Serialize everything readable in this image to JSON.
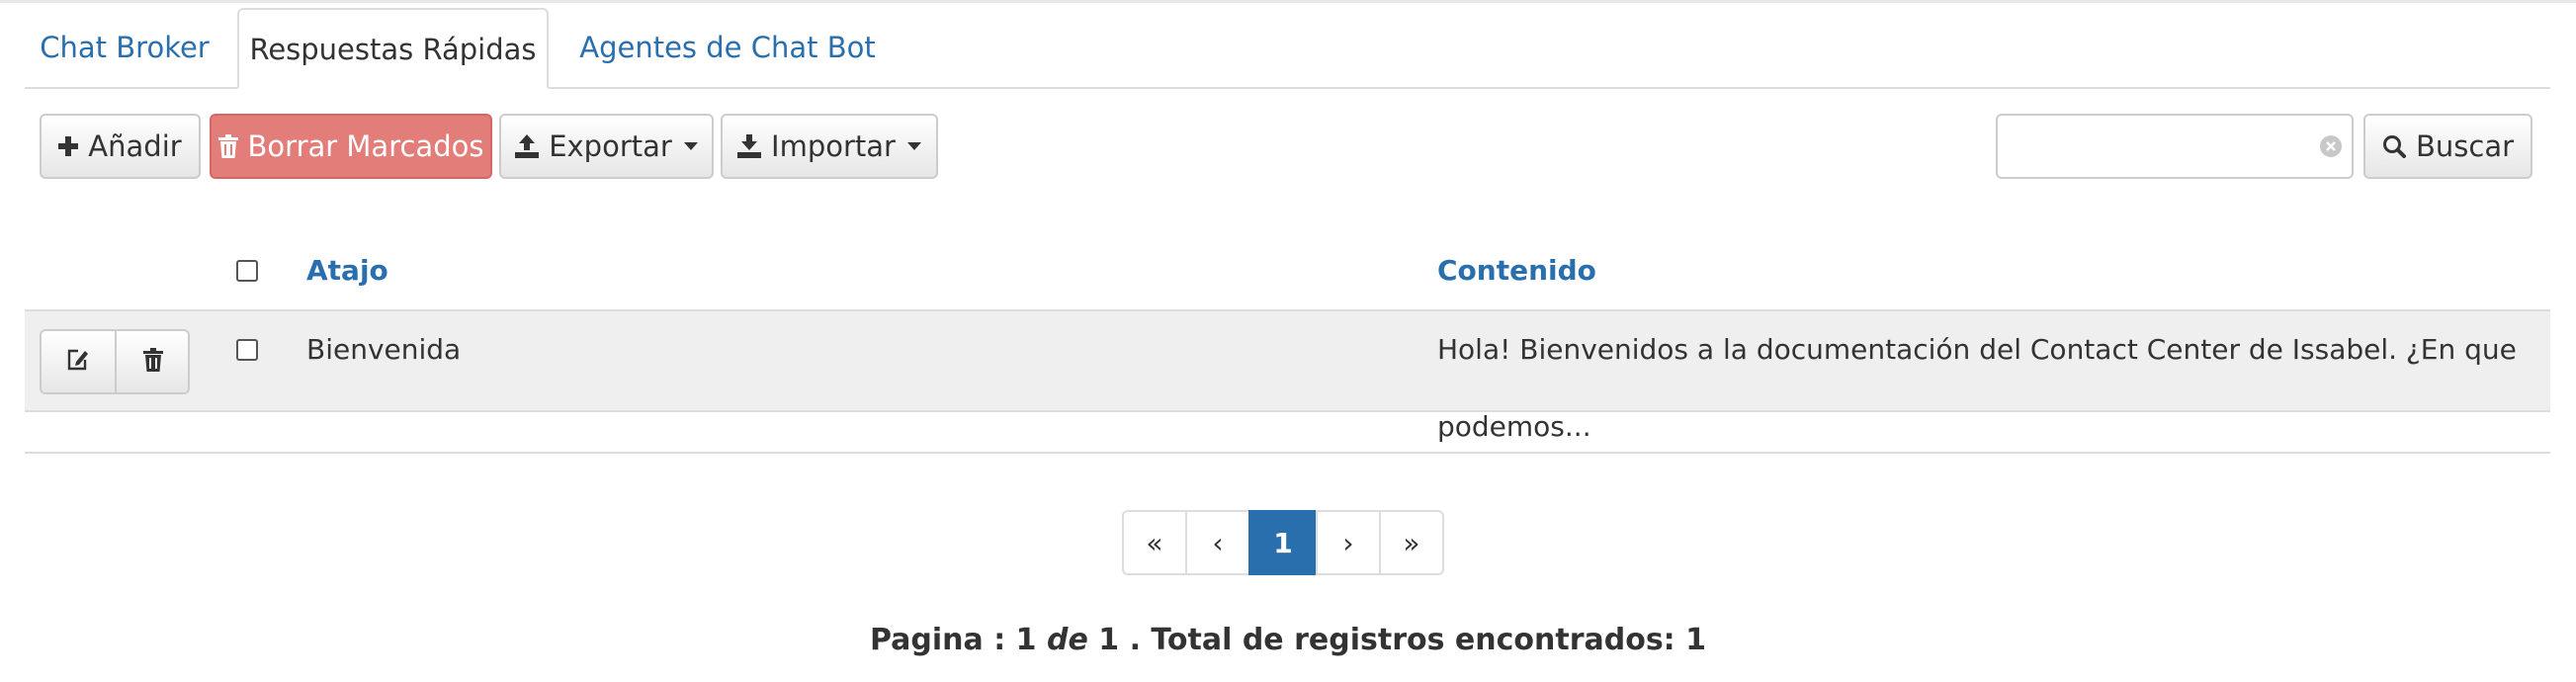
{
  "tabs": [
    {
      "label": "Chat Broker"
    },
    {
      "label": "Respuestas Rápidas"
    },
    {
      "label": "Agentes de Chat Bot"
    }
  ],
  "toolbar": {
    "add_label": "Añadir",
    "delete_label": "Borrar Marcados",
    "export_label": "Exportar",
    "import_label": "Importar",
    "search_label": "Buscar",
    "search_value": ""
  },
  "table": {
    "columns": [
      "Atajo",
      "Contenido"
    ],
    "rows": [
      {
        "atajo": "Bienvenida",
        "contenido": "Hola! Bienvenidos a la documentación del Contact Center de Issabel. ¿En que podemos..."
      }
    ]
  },
  "pagination": {
    "first": "«",
    "prev": "‹",
    "current": "1",
    "next": "›",
    "last": "»"
  },
  "summary": {
    "prefix": "Pagina : 1",
    "de": "de",
    "suffix": "1 . Total de registros encontrados: 1"
  },
  "colors": {
    "link": "#2a6fad",
    "danger": "#e37d7a",
    "active_page": "#2a6fad",
    "row_bg": "#efefef"
  }
}
